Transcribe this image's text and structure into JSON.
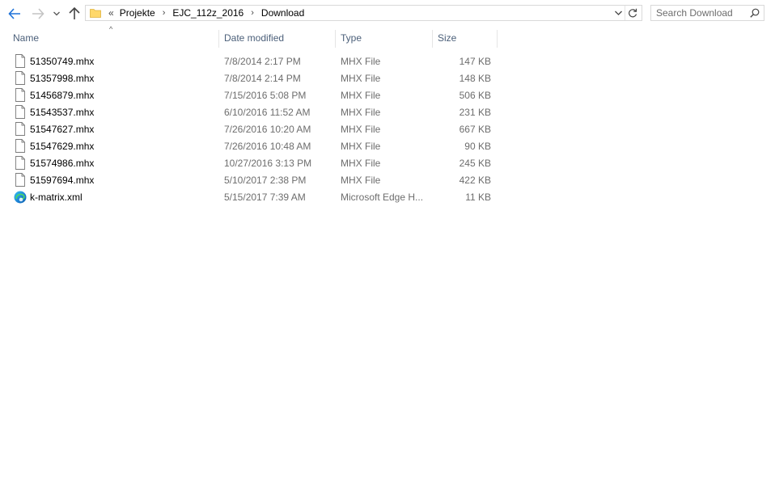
{
  "toolbar": {
    "back_icon": "arrow-left-icon",
    "forward_icon": "arrow-right-icon",
    "recent_icon": "chevron-down-icon",
    "up_icon": "arrow-up-icon"
  },
  "address": {
    "overflow": "«",
    "crumbs": [
      "Projekte",
      "EJC_112z_2016",
      "Download"
    ],
    "separator": "›"
  },
  "search": {
    "placeholder": "Search Download"
  },
  "columns": {
    "name": "Name",
    "date": "Date modified",
    "type": "Type",
    "size": "Size"
  },
  "sort": {
    "column": "name",
    "indicator": "^"
  },
  "files": [
    {
      "name": "51350749.mhx",
      "date": "7/8/2014 2:17 PM",
      "type": "MHX File",
      "size": "147 KB",
      "icon": "file-icon"
    },
    {
      "name": "51357998.mhx",
      "date": "7/8/2014 2:14 PM",
      "type": "MHX File",
      "size": "148 KB",
      "icon": "file-icon"
    },
    {
      "name": "51456879.mhx",
      "date": "7/15/2016 5:08 PM",
      "type": "MHX File",
      "size": "506 KB",
      "icon": "file-icon"
    },
    {
      "name": "51543537.mhx",
      "date": "6/10/2016 11:52 AM",
      "type": "MHX File",
      "size": "231 KB",
      "icon": "file-icon"
    },
    {
      "name": "51547627.mhx",
      "date": "7/26/2016 10:20 AM",
      "type": "MHX File",
      "size": "667 KB",
      "icon": "file-icon"
    },
    {
      "name": "51547629.mhx",
      "date": "7/26/2016 10:48 AM",
      "type": "MHX File",
      "size": "90 KB",
      "icon": "file-icon"
    },
    {
      "name": "51574986.mhx",
      "date": "10/27/2016 3:13 PM",
      "type": "MHX File",
      "size": "245 KB",
      "icon": "file-icon"
    },
    {
      "name": "51597694.mhx",
      "date": "5/10/2017 2:38 PM",
      "type": "MHX File",
      "size": "422 KB",
      "icon": "file-icon"
    },
    {
      "name": "k-matrix.xml",
      "date": "5/15/2017 7:39 AM",
      "type": "Microsoft Edge H...",
      "size": "11 KB",
      "icon": "edge-icon"
    }
  ],
  "colors": {
    "accent": "#1e72d8",
    "header_text": "#4c607a",
    "secondary_text": "#6d6d6d",
    "folder": "#ffd86a"
  }
}
